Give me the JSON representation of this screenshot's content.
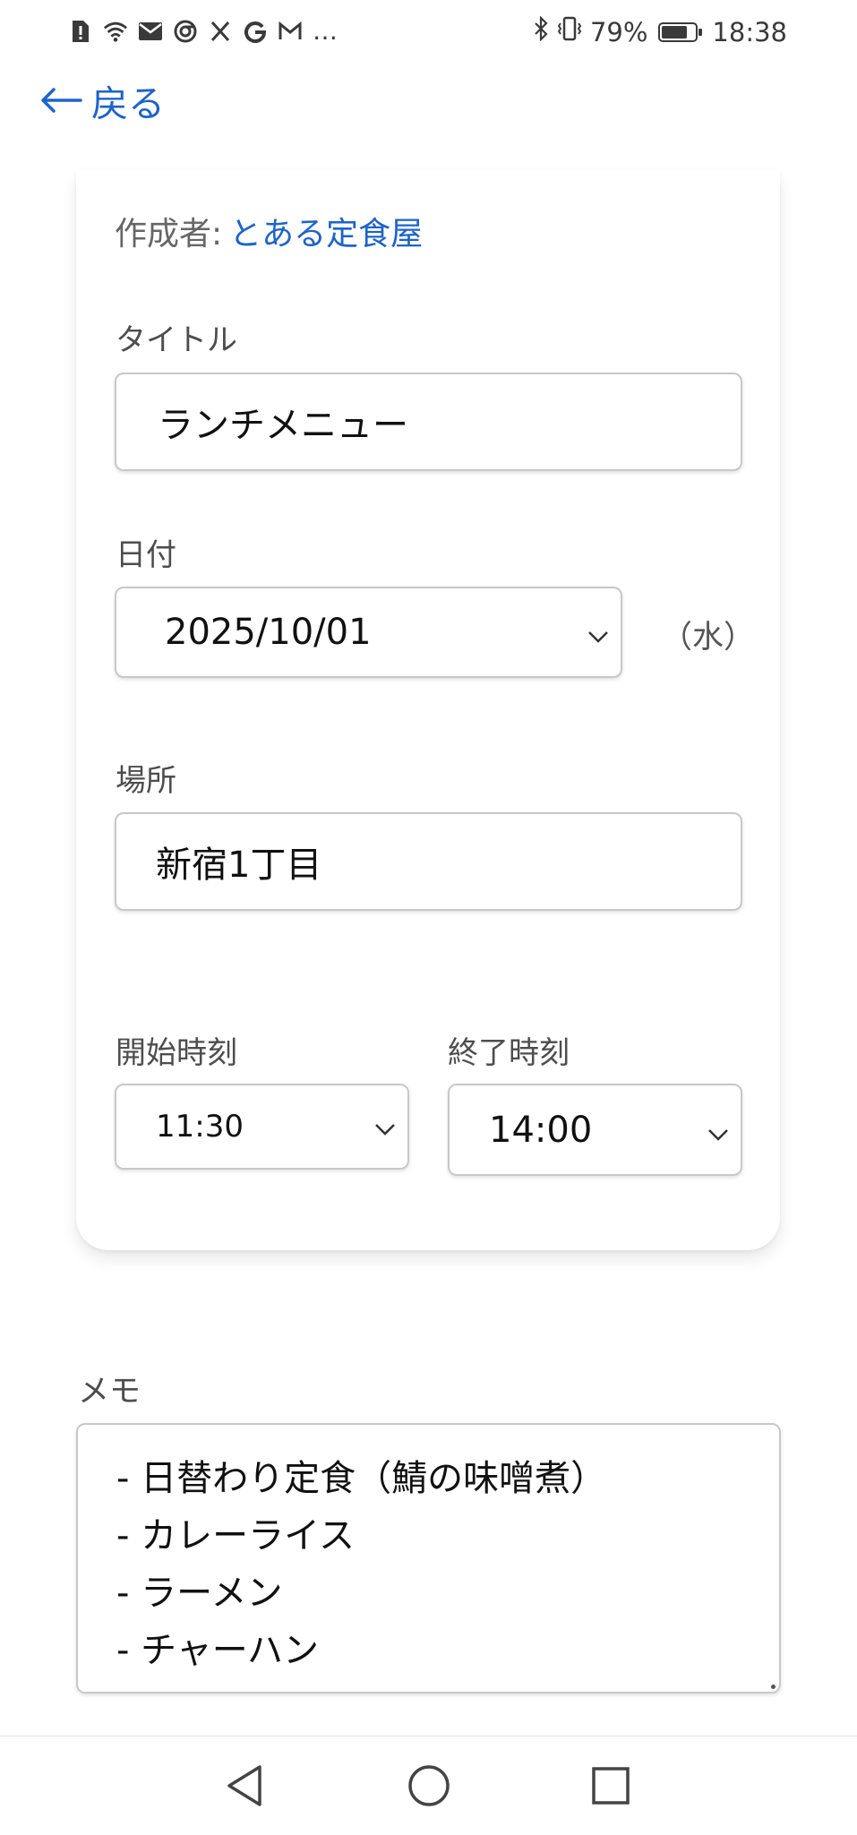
{
  "status_bar": {
    "battery_percent": "79%",
    "battery_level": 0.79,
    "time": "18:38",
    "more_indicator": "…",
    "left_icons": [
      "sim-alert-icon",
      "wifi-icon",
      "mail-icon",
      "chrome-icon",
      "x-icon",
      "google-icon",
      "gmail-icon"
    ],
    "right_icons": [
      "bluetooth-icon",
      "vibrate-icon",
      "battery-icon"
    ]
  },
  "header": {
    "back_label": "戻る"
  },
  "form": {
    "author_key": "作成者:",
    "author_value": "とある定食屋",
    "title_label": "タイトル",
    "title_value": "ランチメニュー",
    "date_label": "日付",
    "date_value": "2025/10/01",
    "weekday": "（水）",
    "place_label": "場所",
    "place_value": "新宿1丁目",
    "start_label": "開始時刻",
    "start_value": "11:30",
    "end_label": "終了時刻",
    "end_value": "14:00"
  },
  "memo": {
    "label": "メモ",
    "lines": [
      "- 日替わり定食（鯖の味噌煮）",
      "- カレーライス",
      "- ラーメン",
      "- チャーハン"
    ]
  },
  "colors": {
    "accent": "#1e63c8",
    "label": "#4d4d4d",
    "border": "#c8c8c8"
  }
}
